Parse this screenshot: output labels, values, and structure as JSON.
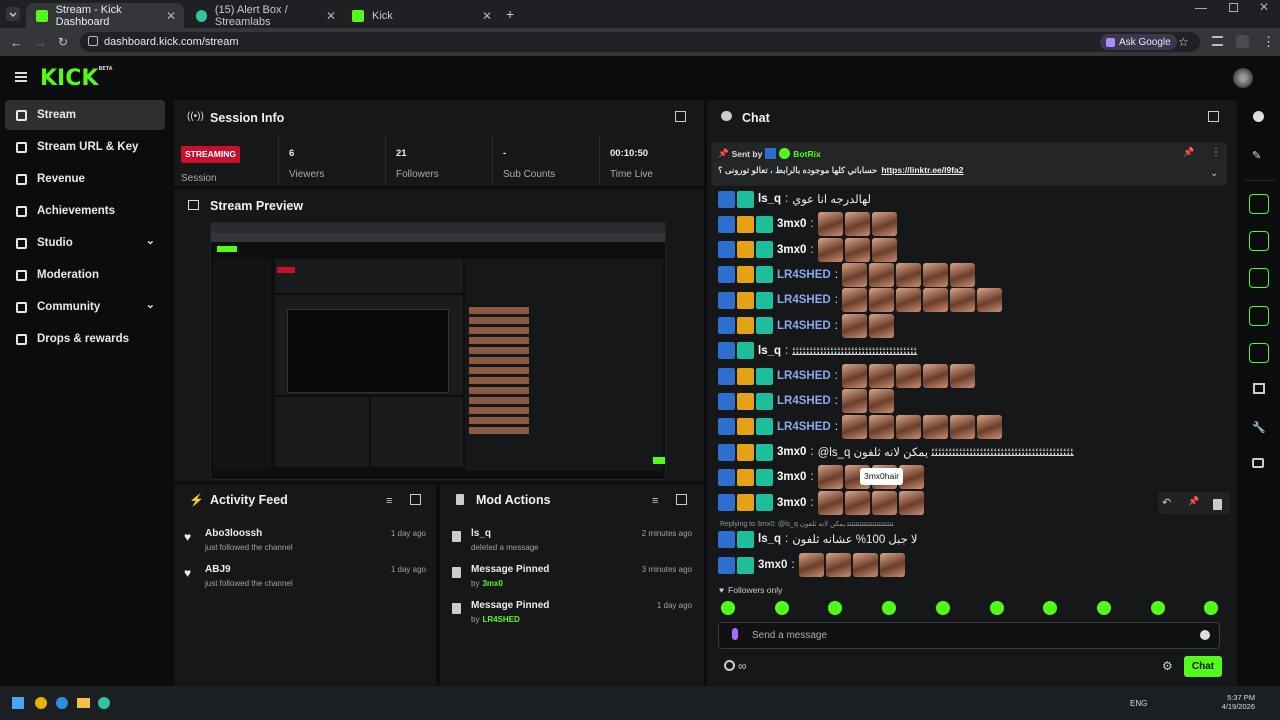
{
  "browser": {
    "tabs": [
      {
        "title": "Stream - Kick Dashboard",
        "active": true
      },
      {
        "title": "(15) Alert Box / Streamlabs",
        "active": false
      },
      {
        "title": "Kick",
        "active": false
      }
    ],
    "url": "dashboard.kick.com/stream",
    "ask_google": "Ask Google"
  },
  "app": {
    "logo": "KICK",
    "logo_badge": "BETA"
  },
  "sidebar": {
    "items": [
      {
        "label": "Stream",
        "icon": "broadcast-icon",
        "active": true
      },
      {
        "label": "Stream URL & Key",
        "icon": "link-icon"
      },
      {
        "label": "Revenue",
        "icon": "chart-icon"
      },
      {
        "label": "Achievements",
        "icon": "trophy-icon"
      },
      {
        "label": "Studio",
        "icon": "grid-icon",
        "expandable": true
      },
      {
        "label": "Moderation",
        "icon": "wrench-icon"
      },
      {
        "label": "Community",
        "icon": "people-icon",
        "expandable": true
      },
      {
        "label": "Drops & rewards",
        "icon": "gift-icon"
      }
    ]
  },
  "session": {
    "title": "Session Info",
    "status_badge": "STREAMING",
    "status_label": "Session",
    "stats": [
      {
        "value": "6",
        "label": "Viewers"
      },
      {
        "value": "21",
        "label": "Followers"
      },
      {
        "value": "-",
        "label": "Sub Counts"
      },
      {
        "value": "00:10:50",
        "label": "Time Live"
      }
    ]
  },
  "preview": {
    "title": "Stream Preview"
  },
  "activity": {
    "title": "Activity Feed",
    "items": [
      {
        "name": "Abo3loossh",
        "sub": "just followed the channel",
        "time": "1 day ago"
      },
      {
        "name": "ABJ9",
        "sub": "just followed the channel",
        "time": "1 day ago"
      }
    ]
  },
  "mod_actions": {
    "title": "Mod Actions",
    "items": [
      {
        "name": "ls_q",
        "sub": "deleted a message",
        "by": "",
        "time": "2 minutes ago",
        "icon": "trash-icon"
      },
      {
        "name": "Message Pinned",
        "sub": "by",
        "by": "3mx0",
        "time": "3 minutes ago",
        "icon": "pin-icon"
      },
      {
        "name": "Message Pinned",
        "sub": "by",
        "by": "LR4SHED",
        "time": "1 day ago",
        "icon": "pin-icon"
      }
    ]
  },
  "chat": {
    "title": "Chat",
    "pinned": {
      "sent_by_label": "Sent by",
      "sender": "BotRix",
      "text": "حساباتي كلها موجوده بالرابط ، تعالو تورونى ؟",
      "link": "https://linktr.ee/l9fa2"
    },
    "messages": [
      {
        "user": "ls_q",
        "color": "#ffffff",
        "text": "لهالدرجه انا عوي",
        "emotes": 0,
        "crown": false
      },
      {
        "user": "3mx0",
        "color": "#ffffff",
        "text": "",
        "emotes": 3,
        "crown": true
      },
      {
        "user": "3mx0",
        "color": "#ffffff",
        "text": "",
        "emotes": 3,
        "crown": true
      },
      {
        "user": "LR4SHED",
        "color": "#8aa9f0",
        "text": "",
        "emotes": 5,
        "crown": true
      },
      {
        "user": "LR4SHED",
        "color": "#8aa9f0",
        "text": "",
        "emotes": 6,
        "crown": true
      },
      {
        "user": "LR4SHED",
        "color": "#8aa9f0",
        "text": "",
        "emotes": 2,
        "crown": true
      },
      {
        "user": "ls_q",
        "color": "#ffffff",
        "text": "ﺌﺌﺌﺌﺌﺌﺌﺌﺌﺌﺌﺌﺌﺌﺌﺌﺌﺌﺌﺌﺌﺌﺌﺌﺌﺌﺌﺌﺌﺌﺌﺌﺌﺌﺌﺌ",
        "emotes": 0,
        "crown": false
      },
      {
        "user": "LR4SHED",
        "color": "#8aa9f0",
        "text": "",
        "emotes": 5,
        "crown": true
      },
      {
        "user": "LR4SHED",
        "color": "#8aa9f0",
        "text": "",
        "emotes": 2,
        "crown": true
      },
      {
        "user": "LR4SHED",
        "color": "#8aa9f0",
        "text": "",
        "emotes": 6,
        "crown": true
      },
      {
        "user": "3mx0",
        "color": "#ffffff",
        "text": "@ls_q ﺌﺌﺌﺌﺌﺌﺌﺌﺌﺌﺌﺌﺌﺌﺌﺌﺌﺌﺌﺌﺌﺌﺌﺌﺌﺌﺌﺌﺌﺌﺌﺌﺌﺌﺌﺌﺌﺌﺌﺌﺌ يمكن لانه ثلفون",
        "emotes": 0,
        "crown": true
      },
      {
        "user": "3mx0",
        "color": "#ffffff",
        "text": "",
        "emotes": 4,
        "crown": true
      },
      {
        "user": "3mx0",
        "color": "#ffffff",
        "text": "",
        "emotes": 4,
        "crown": true
      }
    ],
    "tooltip": "3mx0hair",
    "reply_note": "Replying to 3mx0: @ls_q ﺌﺌﺌﺌﺌﺌﺌﺌﺌﺌﺌﺌﺌﺌﺌﺌﺌﺌﺌﺌﺌﺌ يمكن لانه ثلفون",
    "reply_message": {
      "user": "ls_q",
      "text": "لا جبل 100% عشانه ثلفون"
    },
    "last_message": {
      "user": "3mx0",
      "emotes": 4
    },
    "followers_only": "Followers only",
    "input_placeholder": "Send a message",
    "send_button": "Chat",
    "counter": "∞"
  },
  "taskbar": {
    "lang": "ENG",
    "time": "5:37 PM",
    "date": "4/19/2026"
  },
  "colors": {
    "accent": "#53fc18",
    "panel": "#161718",
    "streaming_badge": "#c8102e"
  }
}
